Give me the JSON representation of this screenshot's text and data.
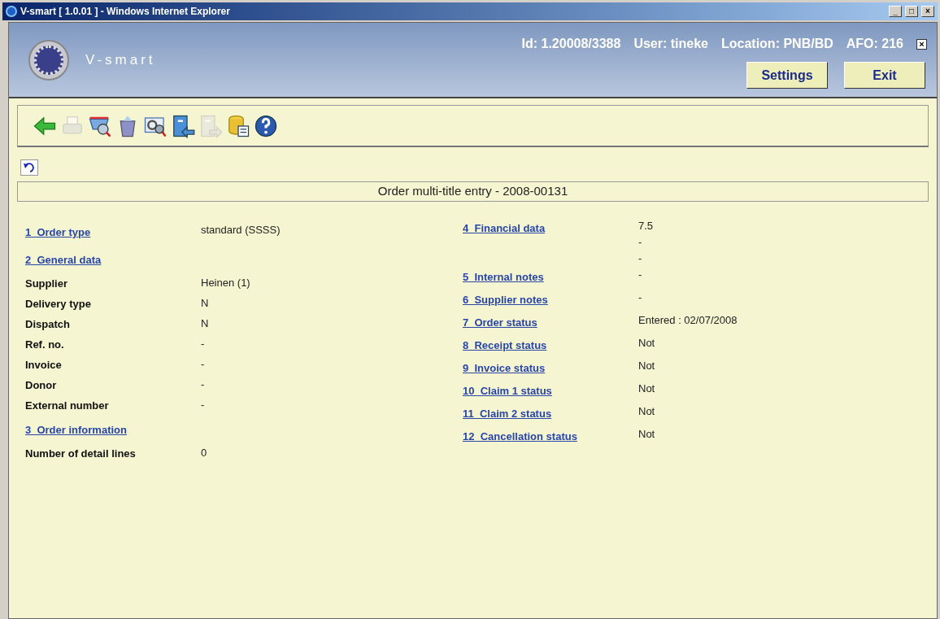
{
  "window": {
    "title": "V-smart [ 1.0.01 ] - Windows Internet Explorer",
    "controls": [
      "_",
      "□",
      "×"
    ]
  },
  "header": {
    "logo_text": "V-smart",
    "info": [
      "Id: 1.20008/3388",
      "User: tineke",
      "Location: PNB/BD",
      "AFO: 216"
    ],
    "close": "×",
    "buttons": [
      "Settings",
      "Exit"
    ]
  },
  "toolbar": [
    {
      "kind": "back",
      "disabled": false
    },
    {
      "kind": "print",
      "disabled": true
    },
    {
      "kind": "cart-search",
      "disabled": false
    },
    {
      "kind": "trash",
      "disabled": false
    },
    {
      "kind": "gear-search",
      "disabled": false
    },
    {
      "kind": "cabinet-in",
      "disabled": false
    },
    {
      "kind": "cabinet-out",
      "disabled": true
    },
    {
      "kind": "database",
      "disabled": false
    },
    {
      "kind": "help",
      "disabled": false
    }
  ],
  "page_title": "Order multi-title entry - 2008-00131",
  "left": [
    {
      "kind": "link",
      "label": "1  Order type",
      "values": [
        "standard (SSSS)"
      ]
    },
    {
      "kind": "link",
      "label": "2  General data"
    },
    {
      "kind": "field",
      "label": "Supplier",
      "values": [
        "Heinen (1)"
      ]
    },
    {
      "kind": "field",
      "label": "Delivery type",
      "values": [
        "N"
      ]
    },
    {
      "kind": "field",
      "label": "Dispatch",
      "values": [
        "N"
      ]
    },
    {
      "kind": "field",
      "label": "Ref. no.",
      "values": [
        "-"
      ]
    },
    {
      "kind": "field",
      "label": "Invoice",
      "values": [
        "-"
      ]
    },
    {
      "kind": "field",
      "label": "Donor",
      "values": [
        "-"
      ]
    },
    {
      "kind": "field",
      "label": "External number",
      "values": [
        "-"
      ]
    },
    {
      "kind": "link",
      "label": "3  Order information"
    },
    {
      "kind": "field",
      "label": "Number of detail lines",
      "values": [
        "0"
      ]
    }
  ],
  "right": [
    {
      "kind": "link",
      "label": "4  Financial data",
      "values": [
        "7.5",
        "-",
        "-"
      ]
    },
    {
      "kind": "link",
      "label": "5  Internal notes",
      "values": [
        "-"
      ]
    },
    {
      "kind": "link",
      "label": "6  Supplier notes",
      "values": [
        "-"
      ]
    },
    {
      "kind": "link",
      "label": "7  Order status",
      "values": [
        "Entered : 02/07/2008"
      ]
    },
    {
      "kind": "link",
      "label": "8  Receipt status",
      "values": [
        "Not"
      ]
    },
    {
      "kind": "link",
      "label": "9  Invoice status",
      "values": [
        "Not"
      ]
    },
    {
      "kind": "link",
      "label": "10  Claim 1 status",
      "values": [
        "Not"
      ]
    },
    {
      "kind": "link",
      "label": "11  Claim 2 status",
      "values": [
        "Not"
      ]
    },
    {
      "kind": "link",
      "label": "12  Cancellation status",
      "values": [
        "Not"
      ]
    }
  ]
}
